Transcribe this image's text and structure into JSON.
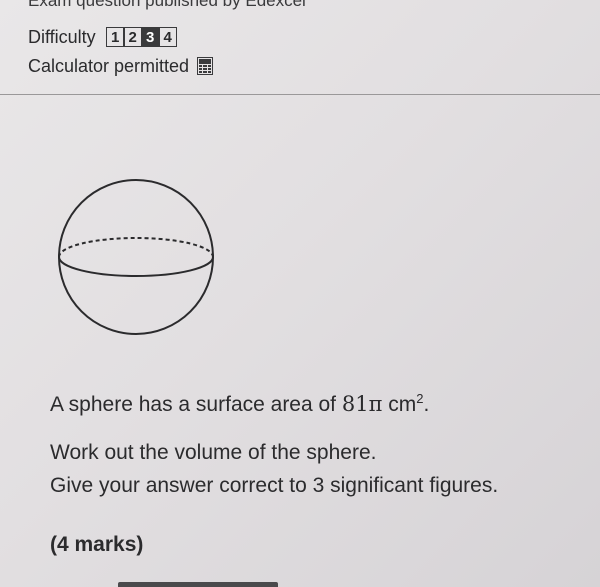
{
  "header": {
    "partial_title": "Exam question published by Edexcel"
  },
  "difficulty": {
    "label": "Difficulty",
    "levels": [
      "1",
      "2",
      "3",
      "4"
    ],
    "selected": "3"
  },
  "calculator": {
    "label": "Calculator permitted",
    "icon": "calculator-icon"
  },
  "diagram": {
    "shape": "sphere"
  },
  "question": {
    "prefix": "A sphere has a surface area of ",
    "value": "81π",
    "unit": "cm",
    "exponent": "2",
    "suffix": "."
  },
  "instructions": {
    "line1": "Work out the volume of the sphere.",
    "line2": "Give your answer correct to 3 significant figures."
  },
  "marks": "(4 marks)"
}
